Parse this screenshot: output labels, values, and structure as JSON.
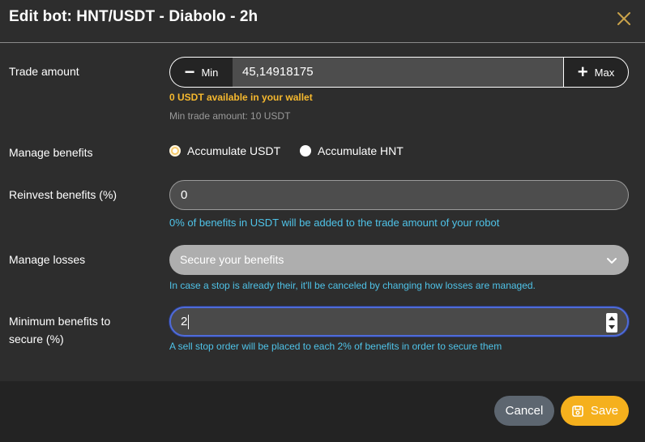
{
  "header": {
    "title": "Edit bot: HNT/USDT - Diabolo - 2h",
    "close_icon": "close-icon"
  },
  "trade_amount": {
    "label": "Trade amount",
    "min_label": "Min",
    "max_label": "Max",
    "value": "45,14918175",
    "wallet_message": "0 USDT available in your wallet",
    "min_trade": "Min trade amount: 10 USDT"
  },
  "manage_benefits": {
    "label": "Manage benefits",
    "options": [
      "Accumulate USDT",
      "Accumulate HNT"
    ],
    "selected": "Accumulate USDT"
  },
  "reinvest": {
    "label": "Reinvest benefits (%)",
    "value": "0",
    "hint": "0% of benefits in USDT will be added to the trade amount of your robot"
  },
  "manage_losses": {
    "label": "Manage losses",
    "selected": "Secure your benefits",
    "hint": "In case a stop is already their, it'll be canceled by changing how losses are managed."
  },
  "min_benefits": {
    "label_line1": "Minimum benefits to",
    "label_line2": "secure (%)",
    "value": "2",
    "hint": "A sell stop order will be placed to each 2% of benefits in order to secure them"
  },
  "footer": {
    "cancel_label": "Cancel",
    "save_label": "Save"
  },
  "colors": {
    "accent": "#f5b01d",
    "hint": "#4fc3e8",
    "warning": "#f5b82e",
    "cancel": "#5d6670"
  }
}
